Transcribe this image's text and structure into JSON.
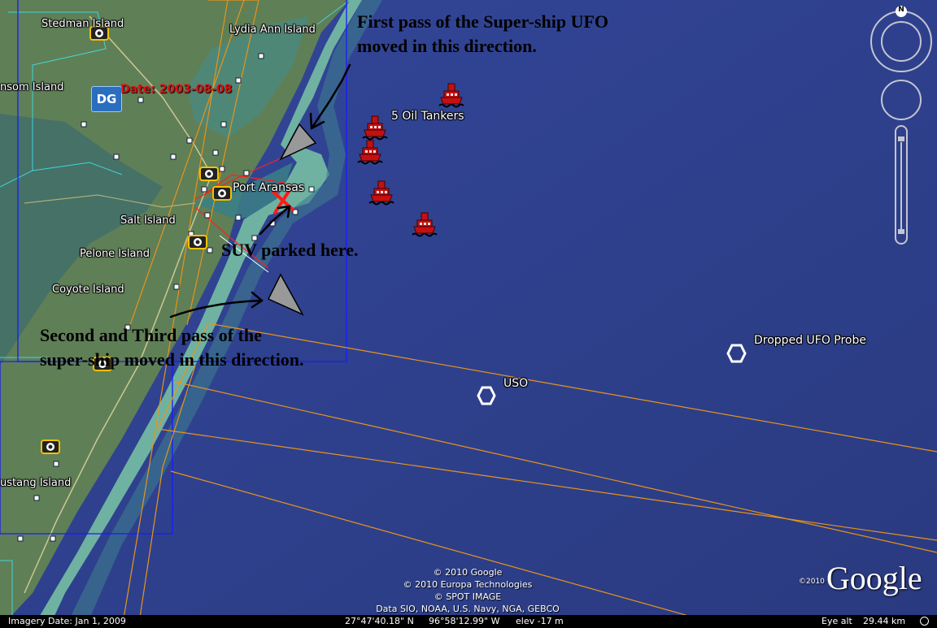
{
  "map": {
    "places": [
      {
        "label": "Stedman Island"
      },
      {
        "label": "Lydia Ann Island"
      },
      {
        "label": "nsom Island"
      },
      {
        "label": "Port Aransas"
      },
      {
        "label": "Salt Island"
      },
      {
        "label": "Pelone Island"
      },
      {
        "label": "Coyote Island"
      },
      {
        "label": "ustang Island"
      }
    ],
    "markers": {
      "tankers_label": "5 Oil Tankers",
      "probe_label": "Dropped UFO Probe",
      "uso_label": "USO"
    },
    "imagery_badge": {
      "text": "DG",
      "date": "Date: 2003-08-08"
    }
  },
  "annotations": {
    "first_pass_line1": "First pass of the Super-ship UFO",
    "first_pass_line2": "moved in this direction.",
    "suv": "SUV parked here.",
    "second_pass_line1": "Second and Third pass of the",
    "second_pass_line2": "super-ship moved in this direction."
  },
  "credits": [
    "© 2010 Google",
    "© 2010 Europa Technologies",
    "© SPOT IMAGE",
    "Data SIO, NOAA, U.S. Navy, NGA, GEBCO"
  ],
  "logo": {
    "copyright": "©2010",
    "text": "Google"
  },
  "controls": {
    "north_label": "N"
  },
  "status_bar": {
    "imagery_date": "Imagery Date: Jan  1, 2009",
    "latitude": "27°47'40.18\" N",
    "longitude": "96°58'12.99\" W",
    "elevation": "elev  -17 m",
    "eye_alt_label": "Eye alt",
    "eye_alt_value": "29.44 km"
  },
  "colors": {
    "water": "#2c3d86",
    "land": "#5f7f57",
    "beach": "#5fa69a",
    "overlay_blue": "#1a1aff",
    "overlay_orange": "#e8941a",
    "tanker": "#c41010"
  }
}
